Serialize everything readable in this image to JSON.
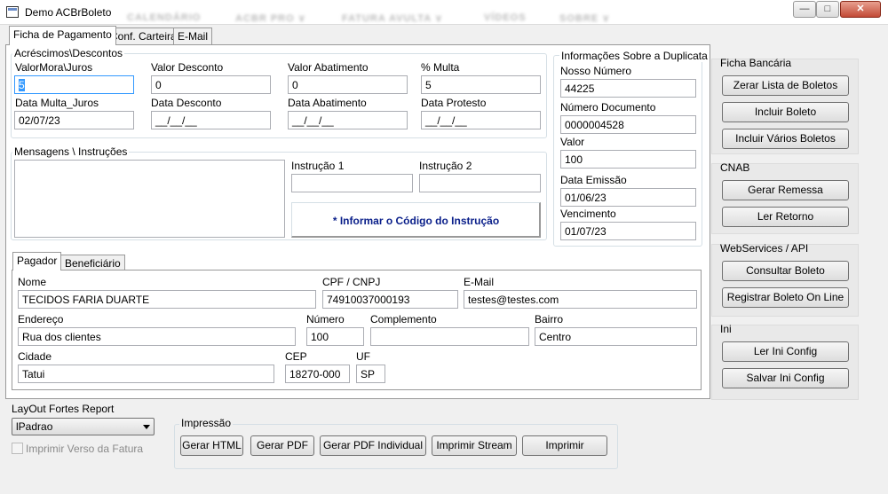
{
  "window": {
    "title": "Demo ACBrBoleto",
    "blur_menu": [
      "CALENDÁRIO",
      "ACBR PRO ∨",
      "FATURA AVULTA ∨",
      "VÍDEOS",
      "SOBRE ∨"
    ],
    "minimize": "—",
    "maximize": "□",
    "close": "✕"
  },
  "tabs": [
    "Ficha de Pagamento",
    "Conf. Carteira",
    "E-Mail"
  ],
  "acrescimos": {
    "title": "Acréscimos\\Descontos",
    "fields": [
      {
        "label": "ValorMora\\Juros",
        "value": "5"
      },
      {
        "label": "Valor Desconto",
        "value": "0"
      },
      {
        "label": "Valor Abatimento",
        "value": "0"
      },
      {
        "label": "% Multa",
        "value": "5"
      },
      {
        "label": "Data Multa_Juros",
        "value": "02/07/23"
      },
      {
        "label": "Data Desconto",
        "value": "__/__/__"
      },
      {
        "label": "Data Abatimento",
        "value": "__/__/__"
      },
      {
        "label": "Data Protesto",
        "value": "__/__/__"
      }
    ]
  },
  "mensagens": {
    "title": "Mensagens \\ Instruções",
    "instrucao1_label": "Instrução 1",
    "instrucao2_label": "Instrução 2",
    "instrucao1_value": "",
    "instrucao2_value": "",
    "note": "* Informar o Código do Instrução"
  },
  "duplicata": {
    "title": "Informações Sobre a Duplicata",
    "fields": [
      {
        "label": "Nosso Número",
        "value": "44225"
      },
      {
        "label": "Número Documento",
        "value": "0000004528"
      },
      {
        "label": "Valor",
        "value": "100"
      },
      {
        "label": "Data Emissão",
        "value": "01/06/23"
      },
      {
        "label": "Vencimento",
        "value": "01/07/23"
      }
    ]
  },
  "subtabs": [
    "Pagador",
    "Beneficiário"
  ],
  "pagador": {
    "nome": {
      "label": "Nome",
      "value": "TECIDOS FARIA DUARTE"
    },
    "cpf": {
      "label": "CPF / CNPJ",
      "value": "74910037000193"
    },
    "email": {
      "label": "E-Mail",
      "value": "testes@testes.com"
    },
    "endereco": {
      "label": "Endereço",
      "value": "Rua dos clientes"
    },
    "numero": {
      "label": "Número",
      "value": "100"
    },
    "complemento": {
      "label": "Complemento",
      "value": ""
    },
    "bairro": {
      "label": "Bairro",
      "value": "Centro"
    },
    "cidade": {
      "label": "Cidade",
      "value": "Tatui"
    },
    "cep": {
      "label": "CEP",
      "value": "18270-000"
    },
    "uf": {
      "label": "UF",
      "value": "SP"
    }
  },
  "layout": {
    "label": "LayOut Fortes Report",
    "selected": "lPadrao",
    "checkbox_label": "Imprimir Verso da Fatura"
  },
  "impressao": {
    "title": "Impressão",
    "buttons": [
      "Gerar HTML",
      "Gerar PDF",
      "Gerar PDF Individual",
      "Imprimir Stream",
      "Imprimir"
    ]
  },
  "side": {
    "ficha": {
      "title": "Ficha Bancária",
      "buttons": [
        "Zerar Lista de Boletos",
        "Incluir Boleto",
        "Incluir Vários Boletos"
      ]
    },
    "cnab": {
      "title": "CNAB",
      "buttons": [
        "Gerar Remessa",
        "Ler Retorno"
      ]
    },
    "ws": {
      "title": "WebServices / API",
      "buttons": [
        "Consultar Boleto",
        "Registrar Boleto On Line"
      ]
    },
    "ini": {
      "title": "Ini",
      "buttons": [
        "Ler Ini Config",
        "Salvar Ini Config"
      ]
    }
  }
}
